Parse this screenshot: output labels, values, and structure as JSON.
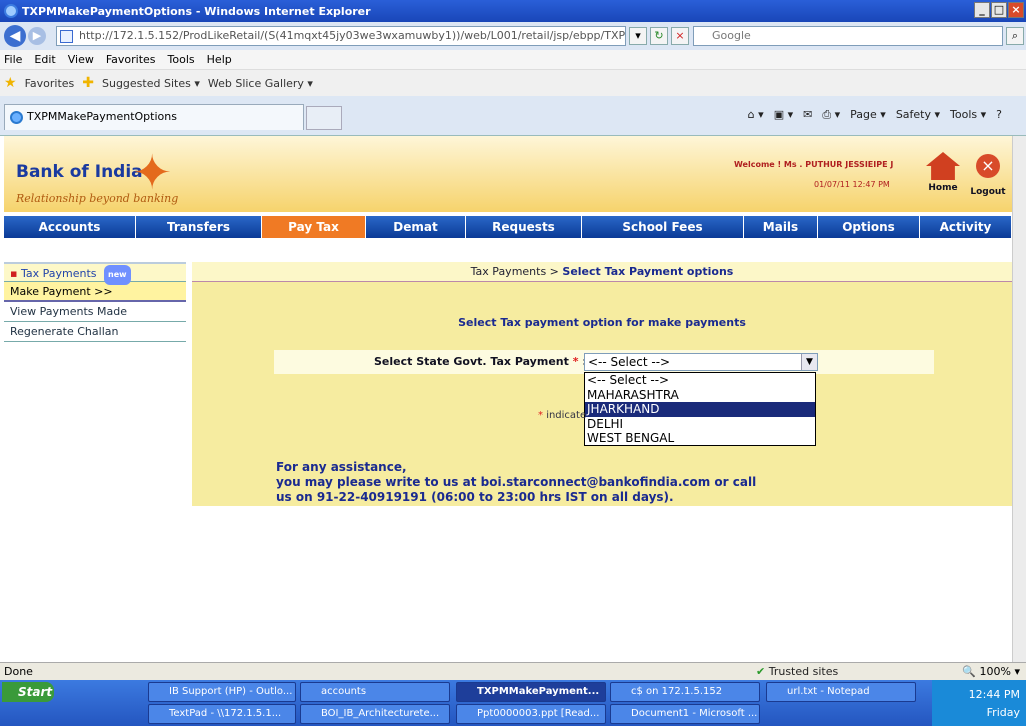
{
  "window": {
    "title": "TXPMMakePaymentOptions - Windows Internet Explorer"
  },
  "address": {
    "url": "http://172.1.5.152/ProdLikeRetail/(S(41mqxt45jy03we3wxamuwby1))/web/L001/retail/jsp/ebpp/TXPMMakePymt",
    "search_placeholder": "Google"
  },
  "menu": [
    "File",
    "Edit",
    "View",
    "Favorites",
    "Tools",
    "Help"
  ],
  "favorites": {
    "label": "Favorites",
    "items": [
      "Suggested Sites ▾",
      "Web Slice Gallery ▾"
    ]
  },
  "tab": {
    "title": "TXPMMakePaymentOptions"
  },
  "commandbar": [
    "Page ▾",
    "Safety ▾",
    "Tools ▾"
  ],
  "bank": {
    "name": "Bank of India",
    "tagline": "Relationship beyond banking",
    "welcome": "Welcome ! Ms . PUTHUR JESSIEIPE J",
    "datetime": "01/07/11 12:47 PM",
    "home_label": "Home",
    "logout_label": "Logout"
  },
  "nav": [
    {
      "label": "Accounts",
      "active": false
    },
    {
      "label": "Transfers",
      "active": false
    },
    {
      "label": "Pay Tax",
      "active": true
    },
    {
      "label": "Demat",
      "active": false
    },
    {
      "label": "Requests",
      "active": false
    },
    {
      "label": "School Fees",
      "active": false
    },
    {
      "label": "Mails",
      "active": false
    },
    {
      "label": "Options",
      "active": false
    },
    {
      "label": "Activity",
      "active": false
    }
  ],
  "sidebar": {
    "header": "Tax Payments",
    "badge": "new",
    "items": [
      "Make Payment >>",
      "View Payments Made",
      "Regenerate Challan"
    ]
  },
  "content": {
    "breadcrumb_prefix": "Tax Payments > ",
    "breadcrumb_current": "Select Tax Payment options",
    "option_title": "Select Tax payment option for make payments",
    "select_label": "Select State Govt. Tax Payment",
    "select_value": "<-- Select -->",
    "dropdown_options": [
      "<-- Select -->",
      "MAHARASHTRA",
      "JHARKHAND",
      "DELHI",
      "WEST BENGAL"
    ],
    "highlighted_option": "JHARKHAND",
    "indicates_text": "indicate",
    "assist_line1": "For any assistance,",
    "assist_line2": "you may please write to us at boi.starconnect@bankofindia.com or call",
    "assist_line3": "us on 91-22-40919191 (06:00 to 23:00 hrs IST on all days)."
  },
  "status": {
    "text": "Done",
    "zone": "Trusted sites",
    "zoom": "100%"
  },
  "taskbar": {
    "start": "Start",
    "row1": [
      "IB Support (HP) - Outlo...",
      "accounts",
      "TXPMMakePayment...",
      "c$ on 172.1.5.152",
      "url.txt - Notepad"
    ],
    "row2": [
      "TextPad - \\\\172.1.5.1...",
      "BOI_IB_Architecturete...",
      "Ppt0000003.ppt [Read...",
      "Document1 - Microsoft ..."
    ],
    "time": "12:44 PM",
    "day": "Friday"
  }
}
